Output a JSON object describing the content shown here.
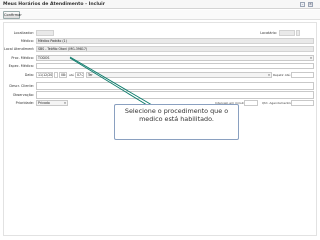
{
  "window": {
    "title": "Meus Horários de Atendimento - Incluir"
  },
  "toolbar": {
    "confirm_label": "Confirmar"
  },
  "form": {
    "localizador_label": "Localizador:",
    "localizador_value": "",
    "locatario_label": "Locatário:",
    "locatario_value": "",
    "medico_label": "Médico:",
    "medico_value": "Médico Padrão (1)",
    "local_label": "Local Atendimento:",
    "local_value": "SBS - Teófilo Otoni (MG-39817)",
    "proc_label": "Proc. Médico:",
    "proc_value": "TODOS",
    "espec_label": "Espec. Médica:",
    "espec_value": "",
    "data_label": "Data:",
    "data_value": "11/12/2012",
    "hora_inicio": "08:00",
    "ate_label": "até",
    "hora_fim": "07:20",
    "dia_value": "Ter",
    "repetir_label": "Repetir Até:",
    "repetir_value": "",
    "desc_label": "Descr. Cliente:",
    "desc_value": "",
    "obs_label": "Observação:",
    "obs_value": "",
    "prioridade_label": "Prioridade:",
    "prioridade_value": "Privado",
    "intervalo_label": "Intervalo em minutos:",
    "intervalo_value": "",
    "qtd_label": "Qtd. Agendamentos:",
    "qtd_value": ""
  },
  "callout": {
    "text": "Selecione o procedimento que o medico está habilitado."
  },
  "colors": {
    "callout_border": "#8aa0c0",
    "callout_line": "#0a7a6a",
    "readonly_field": "#e9e9e9"
  }
}
